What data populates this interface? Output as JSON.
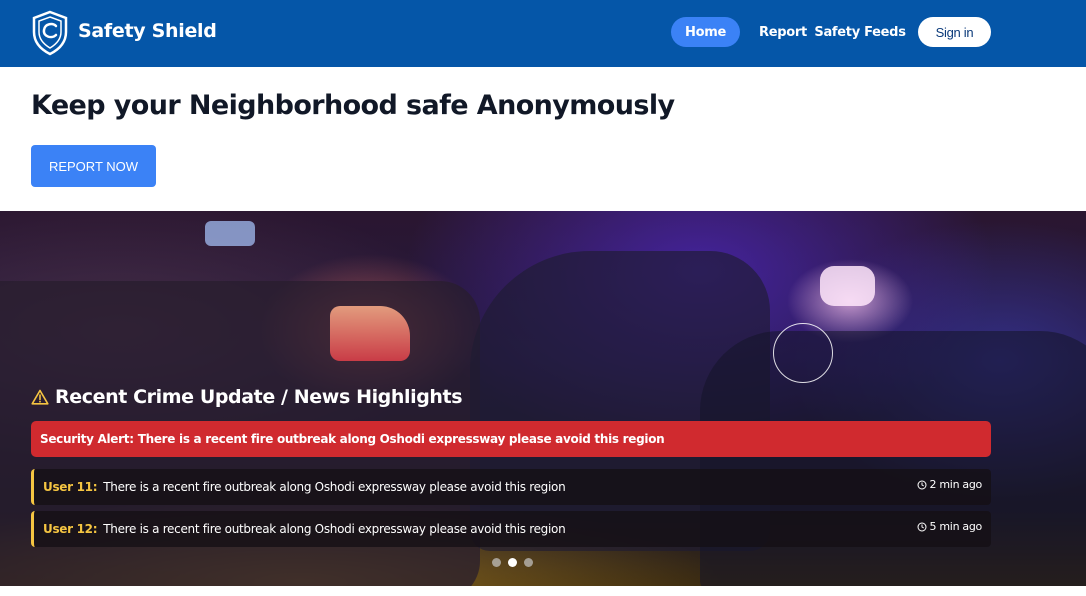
{
  "header": {
    "brand": "Safety Shield",
    "logo_icon": "shield-icon",
    "bg_color": "#0556a8",
    "nav": [
      {
        "label": "Home",
        "active": true
      },
      {
        "label": "Report",
        "active": false
      },
      {
        "label": "Safety Feeds",
        "active": false
      }
    ],
    "signin_label": "Sign in"
  },
  "hero": {
    "title": "Keep your Neighborhood safe Anonymously",
    "cta_label": "REPORT NOW",
    "accent_color": "#3b82f6"
  },
  "updates": {
    "title": "Recent Crime Update / News Highlights",
    "title_icon": "warning-triangle-icon",
    "alert": {
      "prefix": "Security Alert:",
      "text": "There is a recent fire outbreak along Oshodi expressway please avoid this region",
      "color": "#d02a2f"
    },
    "feeds": [
      {
        "user": "User 11:",
        "text": "There is a recent fire outbreak along Oshodi expressway please avoid this region",
        "time": "2 min ago"
      },
      {
        "user": "User 12:",
        "text": "There is a recent fire outbreak along Oshodi expressway please avoid this region",
        "time": "5 min ago"
      }
    ],
    "carousel": {
      "count": 3,
      "active_index": 1
    }
  }
}
